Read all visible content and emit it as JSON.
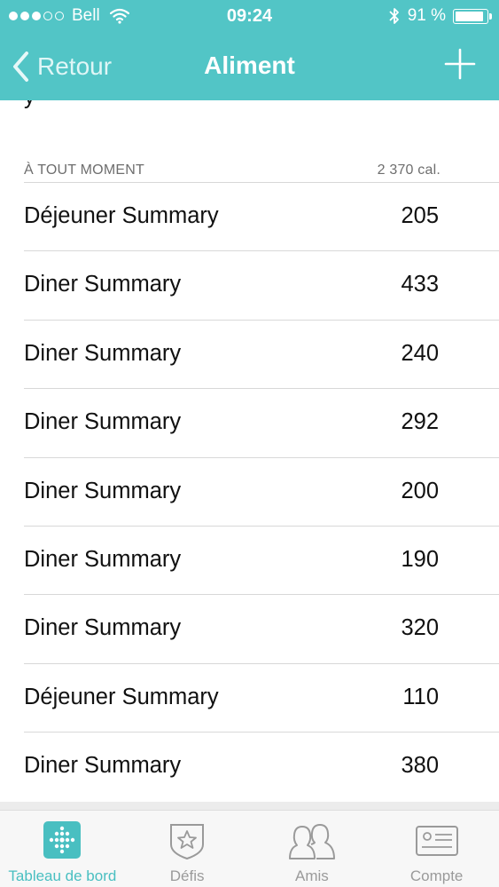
{
  "status_bar": {
    "carrier": "Bell",
    "time": "09:24",
    "battery_percent": "91 %",
    "signal_bars_filled": 3,
    "signal_bars_total": 5
  },
  "nav": {
    "back_label": "Retour",
    "title": "Aliment"
  },
  "cut_text": "y",
  "section": {
    "title": "À TOUT MOMENT",
    "total": "2 370 cal."
  },
  "entries": [
    {
      "name": "Déjeuner Summary",
      "calories": "205"
    },
    {
      "name": "Diner Summary",
      "calories": "433"
    },
    {
      "name": "Diner Summary",
      "calories": "240"
    },
    {
      "name": "Diner Summary",
      "calories": "292"
    },
    {
      "name": "Diner Summary",
      "calories": "200"
    },
    {
      "name": "Diner Summary",
      "calories": "190"
    },
    {
      "name": "Diner Summary",
      "calories": "320"
    },
    {
      "name": "Déjeuner Summary",
      "calories": "110"
    },
    {
      "name": "Diner Summary",
      "calories": "380"
    }
  ],
  "tabs": [
    {
      "label": "Tableau de bord",
      "icon": "dashboard-dots-icon",
      "active": true
    },
    {
      "label": "Défis",
      "icon": "star-badge-icon",
      "active": false
    },
    {
      "label": "Amis",
      "icon": "friends-icon",
      "active": false
    },
    {
      "label": "Compte",
      "icon": "id-card-icon",
      "active": false
    }
  ],
  "colors": {
    "header_bg": "#52c5c6",
    "accent": "#49bfc1",
    "tab_inactive": "#9a9a9a"
  }
}
